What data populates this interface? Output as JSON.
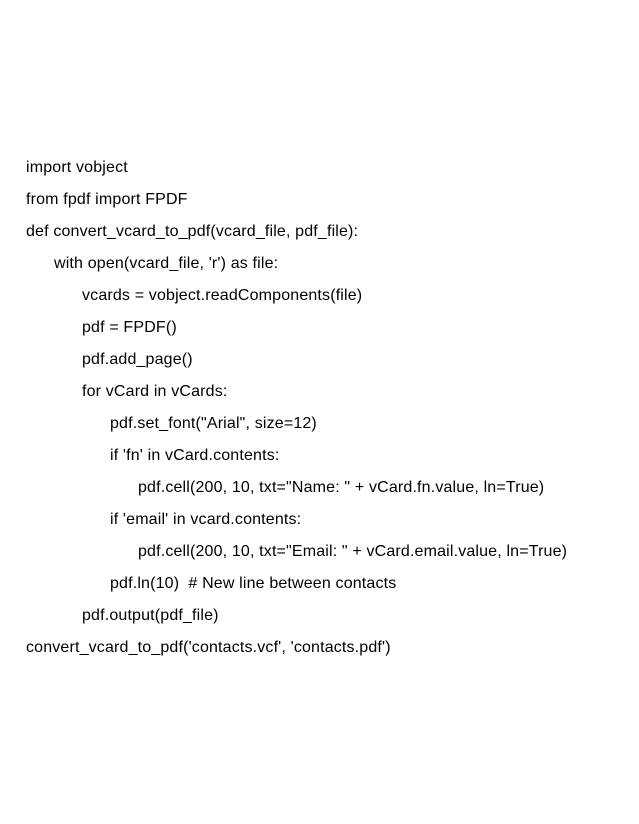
{
  "code": {
    "lines": [
      {
        "text": "import vobject",
        "indent": 0
      },
      {
        "text": "from fpdf import FPDF",
        "indent": 0
      },
      {
        "text": "def convert_vcard_to_pdf(vcard_file, pdf_file):",
        "indent": 0
      },
      {
        "text": "with open(vcard_file, 'r') as file:",
        "indent": 1
      },
      {
        "text": "vcards = vobject.readComponents(file)",
        "indent": 2
      },
      {
        "text": "pdf = FPDF()",
        "indent": 2
      },
      {
        "text": "pdf.add_page()",
        "indent": 2
      },
      {
        "text": "for vCard in vCards:",
        "indent": 2
      },
      {
        "text": "pdf.set_font(\"Arial\", size=12)",
        "indent": 3
      },
      {
        "text": "if 'fn' in vCard.contents:",
        "indent": 3
      },
      {
        "text": "pdf.cell(200, 10, txt=\"Name: \" + vCard.fn.value, ln=True)",
        "indent": 4
      },
      {
        "text": "if 'email' in vcard.contents:",
        "indent": 3
      },
      {
        "text": "pdf.cell(200, 10, txt=\"Email: \" + vCard.email.value, ln=True)",
        "indent": 4
      },
      {
        "text": "pdf.ln(10)  # New line between contacts",
        "indent": 3
      },
      {
        "text": "pdf.output(pdf_file)",
        "indent": 2
      },
      {
        "text": "convert_vcard_to_pdf('contacts.vcf', 'contacts.pdf')",
        "indent": 0
      }
    ]
  }
}
